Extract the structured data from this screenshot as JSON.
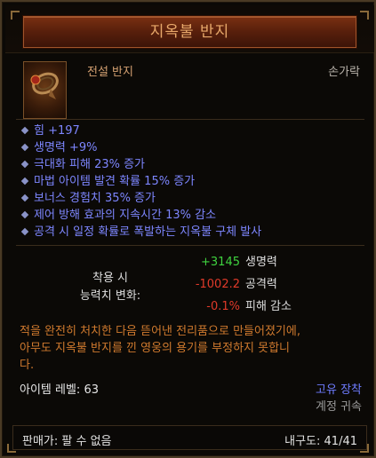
{
  "header": {
    "title": "지옥불 반지"
  },
  "item": {
    "type": "전설 반지",
    "slot": "손가락",
    "icon": "ring-icon",
    "properties": [
      "힘 +197",
      "생명력 +9%",
      "극대화 피해 23% 증가",
      "마법 아이템 발견 확률 15% 증가",
      "보너스 경험치 35% 증가",
      "제어 방해 효과의 지속시간 13% 감소",
      "공격 시 일정 확률로 폭발하는 지옥불 구체 발사"
    ],
    "stat_change": {
      "label_line1": "착용 시",
      "label_line2": "능력치 변화:",
      "rows": [
        {
          "value": "+3145",
          "label": "생명력",
          "color": "#3fd23f"
        },
        {
          "value": "-1002.2",
          "label": "공격력",
          "color": "#e03a2a"
        },
        {
          "value": "-0.1%",
          "label": "피해 감소",
          "color": "#e03a2a"
        }
      ]
    },
    "flavor_lines": [
      "적을 완전히 처치한 다음 뜯어낸 전리품으로 만들어졌기에,",
      "아무도 지옥불 반지를 낀 영웅의 용기를 부정하지 못합니",
      "다."
    ],
    "level": "아이템 레벨: 63",
    "equip_tag": "고유 장착",
    "bound_tag": "계정 귀속"
  },
  "footer": {
    "sell": "판매가: 팔 수 없음",
    "durability": "내구도: 41/41"
  }
}
